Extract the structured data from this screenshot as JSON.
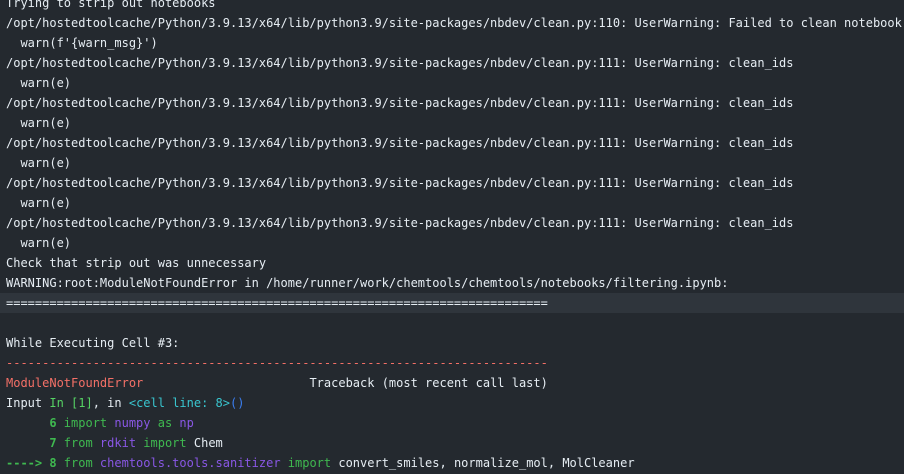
{
  "log": {
    "l0": "Trying to strip out notebooks",
    "l1": "/opt/hostedtoolcache/Python/3.9.13/x64/lib/python3.9/site-packages/nbdev/clean.py:110: UserWarning: Failed to clean notebook",
    "l2": "  warn(f'{warn_msg}')",
    "l3": "/opt/hostedtoolcache/Python/3.9.13/x64/lib/python3.9/site-packages/nbdev/clean.py:111: UserWarning: clean_ids",
    "l4": "  warn(e)",
    "l5": "/opt/hostedtoolcache/Python/3.9.13/x64/lib/python3.9/site-packages/nbdev/clean.py:111: UserWarning: clean_ids",
    "l6": "  warn(e)",
    "l7": "/opt/hostedtoolcache/Python/3.9.13/x64/lib/python3.9/site-packages/nbdev/clean.py:111: UserWarning: clean_ids",
    "l8": "  warn(e)",
    "l9": "/opt/hostedtoolcache/Python/3.9.13/x64/lib/python3.9/site-packages/nbdev/clean.py:111: UserWarning: clean_ids",
    "l10": "  warn(e)",
    "l11": "/opt/hostedtoolcache/Python/3.9.13/x64/lib/python3.9/site-packages/nbdev/clean.py:111: UserWarning: clean_ids",
    "l12": "  warn(e)",
    "l13": "Check that strip out was unnecessary",
    "l14": "WARNING:root:ModuleNotFoundError in /home/runner/work/chemtools/chemtools/notebooks/filtering.ipynb:",
    "l15": "===========================================================================",
    "l16": "",
    "l17": "While Executing Cell #3:",
    "l18": "---------------------------------------------------------------------------",
    "l19_err": "ModuleNotFoundError",
    "l19_tb": "                       Traceback (most recent call last)",
    "l20_a": "Input ",
    "l20_b": "In [1]",
    "l20_c": ", in ",
    "l20_d": "<cell line: 8>",
    "l20_e": "()",
    "l21_num": "      6 ",
    "l21_kw1": "import",
    "l21_mod": " numpy",
    "l21_kw2": " as",
    "l21_alias": " np",
    "l22_num": "      7 ",
    "l22_kw1": "from",
    "l22_mod": " rdkit",
    "l22_kw2": " import",
    "l22_rest": " Chem",
    "l23_arrow": "----> 8 ",
    "l23_kw1": "from",
    "l23_mod": " chemtools.tools.sanitizer",
    "l23_kw2": " import",
    "l23_rest": " convert_smiles, normalize_mol, MolCleaner"
  },
  "colors": {
    "background": "#24292f",
    "highlight_row": "#2f353c",
    "text": "#e6edf3",
    "error_red": "#f47067",
    "green": "#56d364",
    "cyan": "#39c5cf",
    "blue": "#3b7ff3",
    "purple": "#8957e5"
  }
}
